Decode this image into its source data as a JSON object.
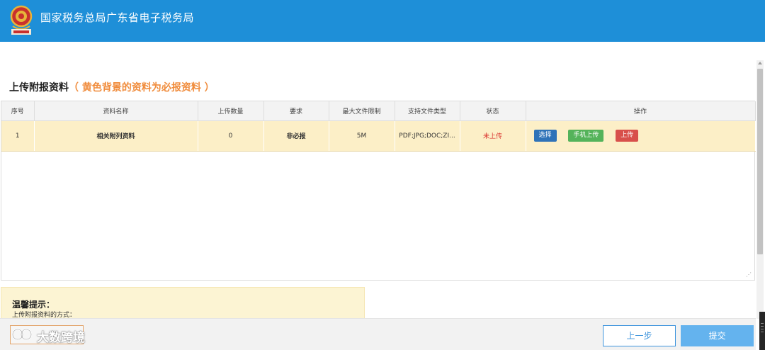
{
  "header": {
    "title": "国家税务总局广东省电子税务局"
  },
  "section": {
    "title": "上传附报资料",
    "note": "（ 黄色背景的资料为必报资料 ）"
  },
  "table": {
    "columns": [
      "序号",
      "资料名称",
      "上传数量",
      "要求",
      "最大文件限制",
      "支持文件类型",
      "状态",
      "操作"
    ],
    "rows": [
      {
        "index": "1",
        "name": "相关附列资料",
        "count": "0",
        "requirement": "非必报",
        "max_size": "5M",
        "types": "PDF;JPG;DOC;ZI...",
        "status": "未上传",
        "actions": {
          "choose": "选择",
          "mobile_upload": "手机上传",
          "upload": "上传"
        }
      }
    ],
    "resize_glyph": "⋰",
    "row_color": "#fcefc7"
  },
  "tips": {
    "title": "温馨提示：",
    "text": "上传附报资料的方式："
  },
  "footer": {
    "prev_label": "上一步",
    "submit_label": "提交"
  },
  "watermark": {
    "text": "大数跨境"
  },
  "colors": {
    "header": "#1e8fd8",
    "status_red": "#d9302c",
    "choose": "#2f73b8",
    "mobile": "#54b35a",
    "upload": "#d8504b",
    "note": "#f08c3c"
  }
}
